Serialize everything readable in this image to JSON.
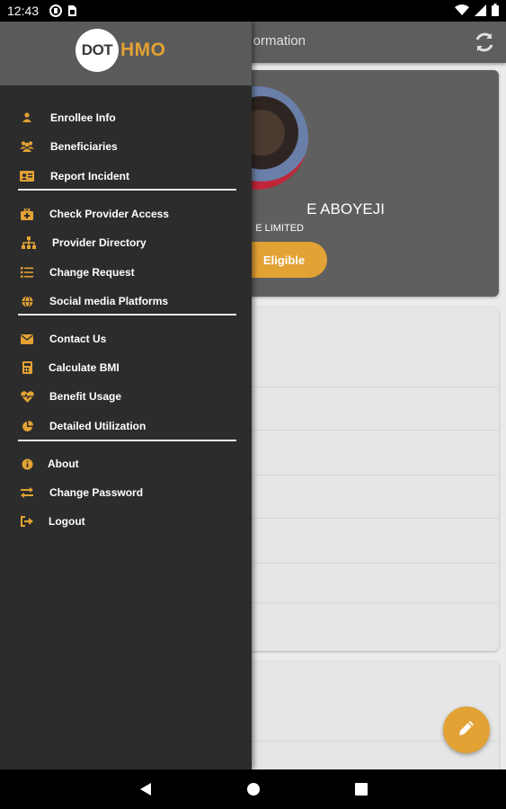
{
  "status_bar": {
    "time": "12:43",
    "left_icons": [
      "data-saver-icon",
      "sim-card-icon"
    ],
    "right_icons": [
      "wifi-icon",
      "signal-icon",
      "battery-icon"
    ]
  },
  "app": {
    "appbar": {
      "title_partial": "ormation",
      "refresh_icon": "refresh-icon"
    },
    "profile": {
      "name_partial": "E ABOYEJI",
      "company_partial": "E LIMITED",
      "eligibility_label": "Eligible"
    },
    "fab_icon": "pencil-icon"
  },
  "drawer": {
    "logo": {
      "dot": "DOT",
      "hmo": "HMO"
    },
    "sections": [
      {
        "items": [
          {
            "label": "Enrollee Info",
            "icon": "person-icon"
          },
          {
            "label": "Beneficiaries",
            "icon": "people-icon"
          },
          {
            "label": "Report Incident",
            "icon": "id-card-icon"
          }
        ]
      },
      {
        "items": [
          {
            "label": "Check Provider Access",
            "icon": "medical-bag-icon"
          },
          {
            "label": "Provider Directory",
            "icon": "sitemap-icon"
          },
          {
            "label": "Change Request",
            "icon": "list-icon"
          },
          {
            "label": "Social media Platforms",
            "icon": "globe-icon"
          }
        ]
      },
      {
        "items": [
          {
            "label": "Contact Us",
            "icon": "envelope-icon"
          },
          {
            "label": "Calculate BMI",
            "icon": "calculator-icon"
          },
          {
            "label": "Benefit Usage",
            "icon": "heartbeat-icon"
          },
          {
            "label": "Detailed Utilization",
            "icon": "pie-chart-icon"
          }
        ]
      },
      {
        "items": [
          {
            "label": "About",
            "icon": "info-icon"
          },
          {
            "label": "Change Password",
            "icon": "exchange-icon"
          },
          {
            "label": "Logout",
            "icon": "sign-out-icon"
          }
        ]
      }
    ]
  },
  "colors": {
    "accent": "#e2a234",
    "drawer_bg": "#2c2c2c",
    "drawer_header_bg": "#5a5a5a",
    "appbar_bg": "#5e5e5e"
  },
  "nav_bar": {
    "buttons": [
      "back-icon",
      "home-icon",
      "recents-icon"
    ]
  }
}
